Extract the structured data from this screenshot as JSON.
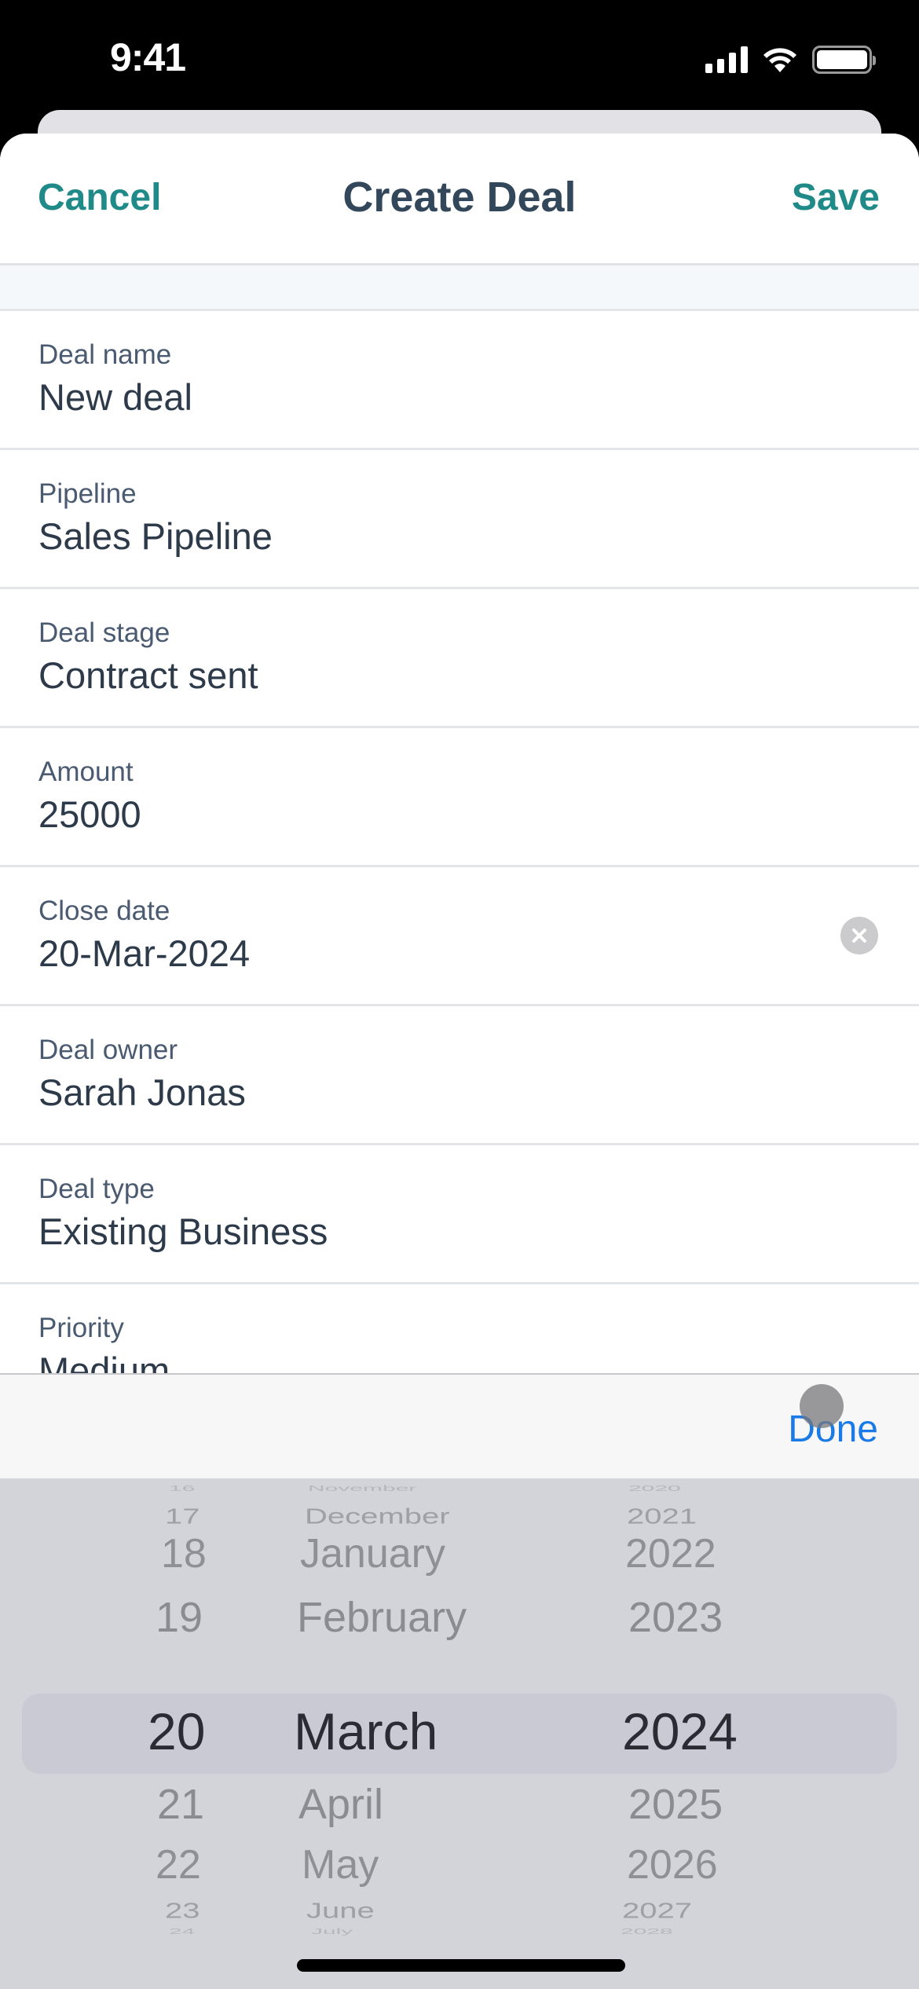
{
  "status_bar": {
    "time": "9:41",
    "icons": [
      "cellular-signal-icon",
      "wifi-icon",
      "battery-icon"
    ]
  },
  "nav": {
    "cancel_label": "Cancel",
    "title": "Create Deal",
    "save_label": "Save"
  },
  "fields": [
    {
      "label": "Deal name",
      "value": "New deal"
    },
    {
      "label": "Pipeline",
      "value": "Sales Pipeline"
    },
    {
      "label": "Deal stage",
      "value": "Contract sent"
    },
    {
      "label": "Amount",
      "value": "25000"
    },
    {
      "label": "Close date",
      "value": "20-Mar-2024",
      "clear_icon": "clear-circle-x-icon"
    },
    {
      "label": "Deal owner",
      "value": "Sarah Jonas"
    },
    {
      "label": "Deal type",
      "value": "Existing Business"
    },
    {
      "label": "Priority",
      "value": "Medium"
    }
  ],
  "accessory": {
    "done_label": "Done"
  },
  "date_picker": {
    "selected": {
      "day": "20",
      "month": "March",
      "year": "2024"
    },
    "days": [
      "16",
      "17",
      "18",
      "19",
      "20",
      "21",
      "22",
      "23",
      "24"
    ],
    "months": [
      "November",
      "December",
      "January",
      "February",
      "March",
      "April",
      "May",
      "June",
      "July"
    ],
    "years": [
      "2020",
      "2021",
      "2022",
      "2023",
      "2024",
      "2025",
      "2026",
      "2027",
      "2028"
    ]
  },
  "colors": {
    "accent_teal": "#1f8a87",
    "title_text": "#33475b",
    "done_blue": "#1a7ae6",
    "picker_bg": "#d2d4d9"
  }
}
